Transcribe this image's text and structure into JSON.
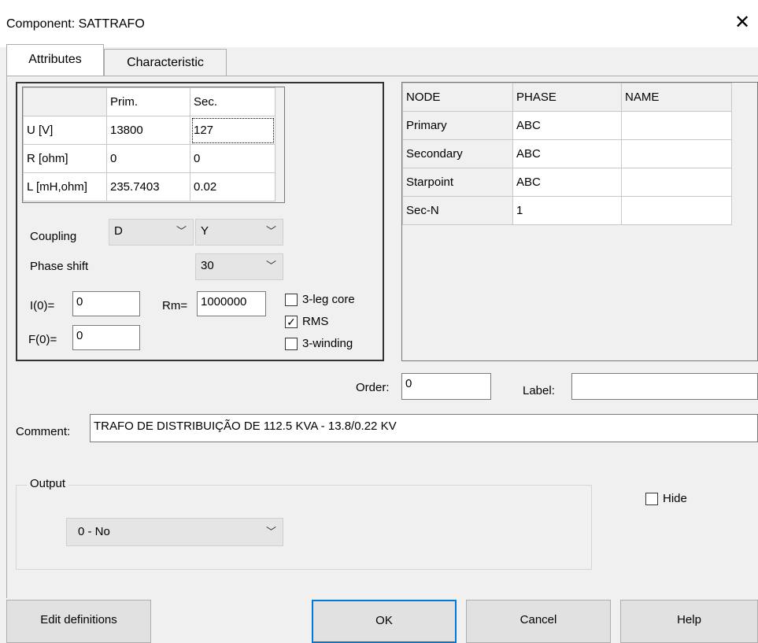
{
  "window": {
    "title": "Component: SATTRAFO",
    "close_glyph": "✕"
  },
  "tabs": [
    {
      "label": "Attributes"
    },
    {
      "label": "Characteristic"
    }
  ],
  "param_table": {
    "headers": [
      "",
      "Prim.",
      "Sec."
    ],
    "rows": [
      [
        "U [V]",
        "13800",
        "127"
      ],
      [
        "R [ohm]",
        "0",
        "0"
      ],
      [
        "L [mH,ohm]",
        "235.7403",
        "0.02"
      ]
    ]
  },
  "coupling": {
    "label": "Coupling",
    "prim_value": "D",
    "sec_value": "Y"
  },
  "phase_shift": {
    "label": "Phase shift",
    "value": "30"
  },
  "fields": {
    "i0_label": "I(0)=",
    "i0_value": "0",
    "f0_label": "F(0)=",
    "f0_value": "0",
    "rm_label": "Rm=",
    "rm_value": "1000000"
  },
  "checkboxes": {
    "three_leg_core": {
      "label": "3-leg core",
      "checked": false
    },
    "rms": {
      "label": "RMS",
      "checked": true
    },
    "three_winding": {
      "label": "3-winding",
      "checked": false
    }
  },
  "node_table": {
    "headers": [
      "NODE",
      "PHASE",
      "NAME"
    ],
    "rows": [
      [
        "Primary",
        "ABC",
        ""
      ],
      [
        "Secondary",
        "ABC",
        ""
      ],
      [
        "Starpoint",
        "ABC",
        ""
      ],
      [
        "Sec-N",
        "1",
        ""
      ]
    ]
  },
  "order": {
    "label": "Order:",
    "value": "0"
  },
  "label_field": {
    "label": "Label:",
    "value": ""
  },
  "comment": {
    "label": "Comment:",
    "value": "TRAFO DE DISTRIBUIÇÃO DE 112.5 KVA - 13.8/0.22 KV"
  },
  "output": {
    "group_label": "Output",
    "selected": "0 - No"
  },
  "hide": {
    "label": "Hide",
    "checked": false
  },
  "buttons": {
    "edit_definitions": "Edit definitions",
    "ok": "OK",
    "cancel": "Cancel",
    "help": "Help"
  },
  "icons": {
    "chevron": "chevron-down-icon",
    "check": "checkmark-icon"
  }
}
